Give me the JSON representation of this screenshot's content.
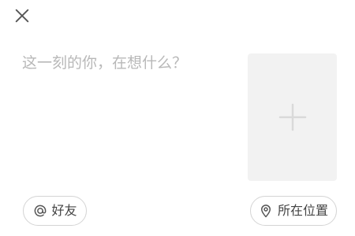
{
  "header": {
    "close_icon": "close-icon"
  },
  "composer": {
    "placeholder": "这一刻的你，在想什么？"
  },
  "media": {
    "add_icon": "plus-icon"
  },
  "actions": {
    "friends": {
      "icon": "at-icon",
      "label": "好友"
    },
    "location": {
      "icon": "location-pin-icon",
      "label": "所在位置"
    }
  },
  "colors": {
    "background": "#ffffff",
    "placeholder": "#b8b8b8",
    "tile": "#f2f2f2",
    "border": "#d4d4d4",
    "icon": "#555555"
  }
}
